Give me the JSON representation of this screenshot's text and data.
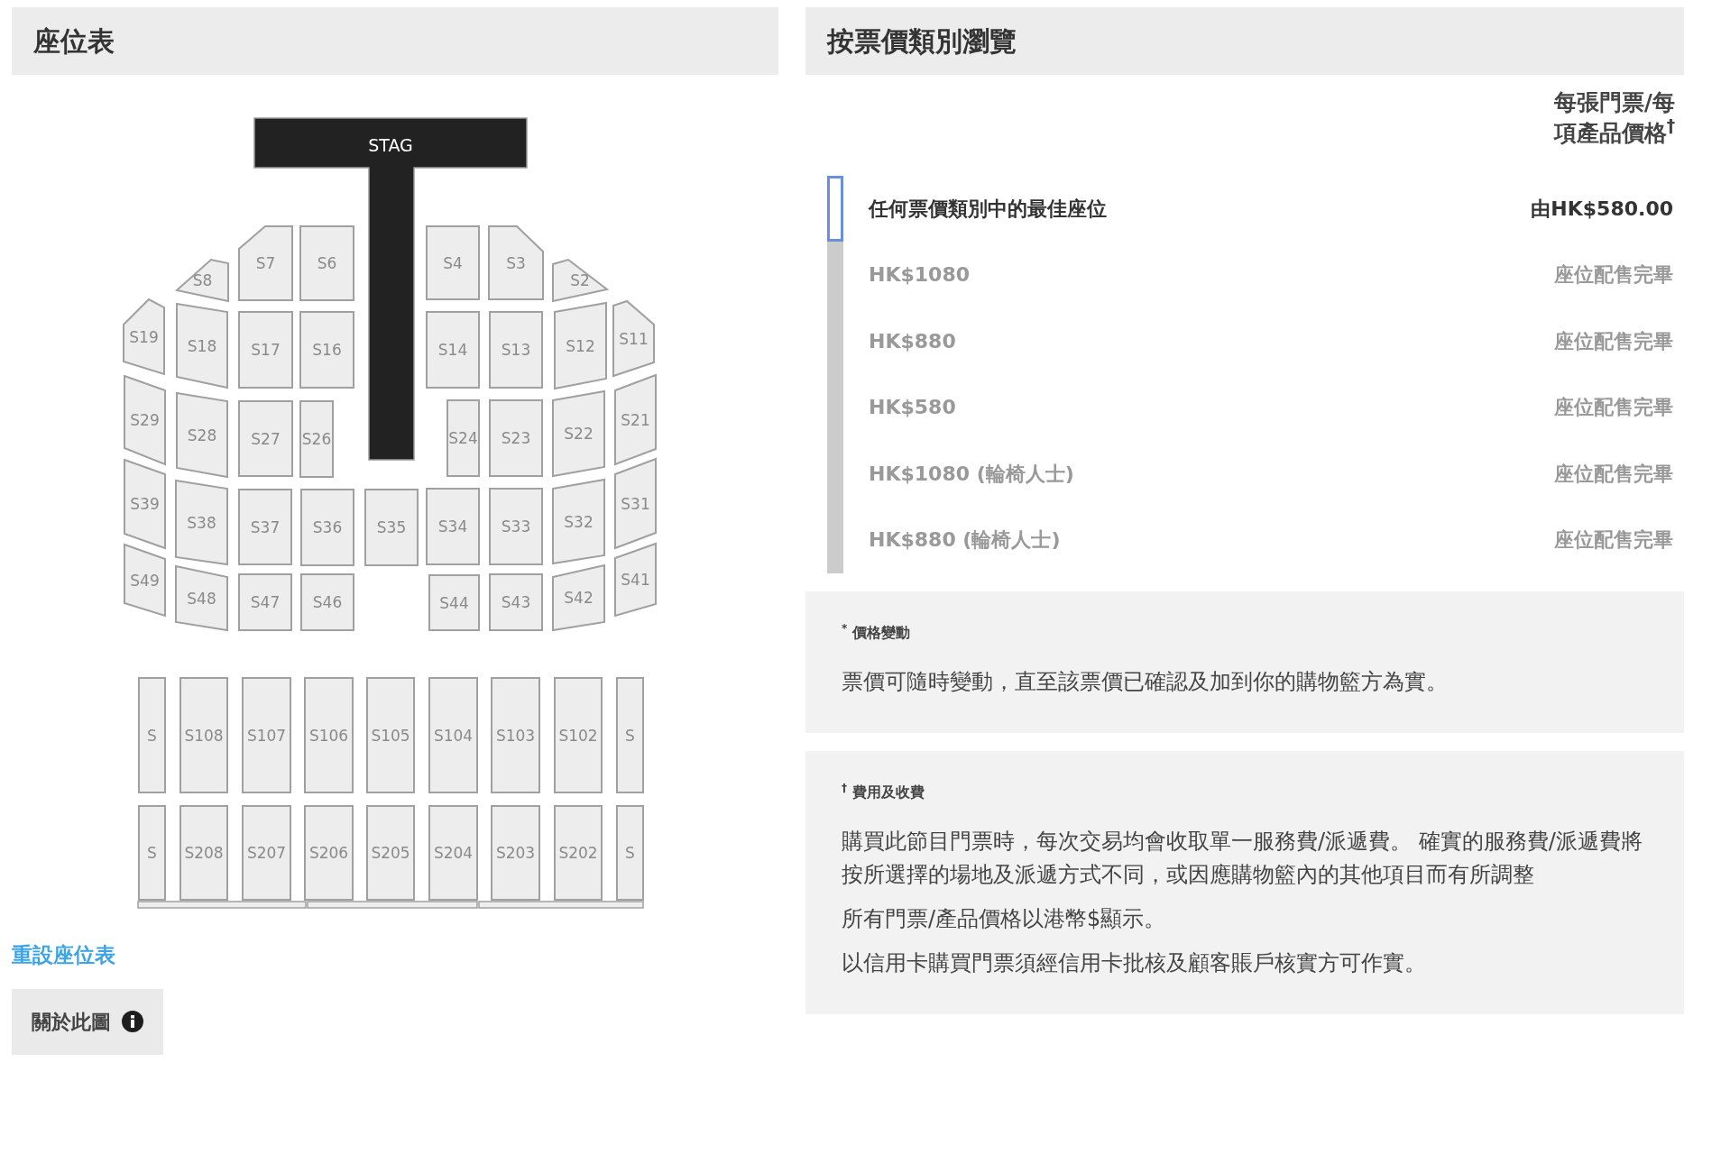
{
  "seat_map": {
    "title": "座位表",
    "stage": {
      "label": "STAG"
    },
    "sections": [
      {
        "label": "S8"
      },
      {
        "label": "S7"
      },
      {
        "label": "S6"
      },
      {
        "label": "S4"
      },
      {
        "label": "S3"
      },
      {
        "label": "S2"
      },
      {
        "label": "S19"
      },
      {
        "label": "S18"
      },
      {
        "label": "S17"
      },
      {
        "label": "S16"
      },
      {
        "label": "S14"
      },
      {
        "label": "S13"
      },
      {
        "label": "S12"
      },
      {
        "label": "S11"
      },
      {
        "label": "S29"
      },
      {
        "label": "S28"
      },
      {
        "label": "S27"
      },
      {
        "label": "S26"
      },
      {
        "label": "S24"
      },
      {
        "label": "S23"
      },
      {
        "label": "S22"
      },
      {
        "label": "S21"
      },
      {
        "label": "S39"
      },
      {
        "label": "S38"
      },
      {
        "label": "S37"
      },
      {
        "label": "S36"
      },
      {
        "label": "S35"
      },
      {
        "label": "S34"
      },
      {
        "label": "S33"
      },
      {
        "label": "S32"
      },
      {
        "label": "S31"
      },
      {
        "label": "S49"
      },
      {
        "label": "S48"
      },
      {
        "label": "S47"
      },
      {
        "label": "S46"
      },
      {
        "label": "S44"
      },
      {
        "label": "S43"
      },
      {
        "label": "S42"
      },
      {
        "label": "S41"
      },
      {
        "label": "S"
      },
      {
        "label": "S108"
      },
      {
        "label": "S107"
      },
      {
        "label": "S106"
      },
      {
        "label": "S105"
      },
      {
        "label": "S104"
      },
      {
        "label": "S103"
      },
      {
        "label": "S102"
      },
      {
        "label": "S"
      },
      {
        "label": "S"
      },
      {
        "label": "S208"
      },
      {
        "label": "S207"
      },
      {
        "label": "S206"
      },
      {
        "label": "S205"
      },
      {
        "label": "S204"
      },
      {
        "label": "S203"
      },
      {
        "label": "S202"
      },
      {
        "label": "S"
      }
    ],
    "reset_link": "重設座位表",
    "about_button": "關於此圖"
  },
  "price_panel": {
    "title": "按票價類別瀏覽",
    "column_header": "每張門票/每項產品價格$^{†}$",
    "rows": [
      {
        "label": "任何票價類別中的最佳座位",
        "price": "由HK$580.00",
        "selected": true,
        "disabled": false
      },
      {
        "label": "HK$1080",
        "price": "座位配售完畢",
        "selected": false,
        "disabled": true
      },
      {
        "label": "HK$880",
        "price": "座位配售完畢",
        "selected": false,
        "disabled": true
      },
      {
        "label": "HK$580",
        "price": "座位配售完畢",
        "selected": false,
        "disabled": true
      },
      {
        "label": "HK$1080 (輪椅人士)",
        "price": "座位配售完畢",
        "selected": false,
        "disabled": true
      },
      {
        "label": "HK$880 (輪椅人士)",
        "price": "座位配售完畢",
        "selected": false,
        "disabled": true
      }
    ]
  },
  "notes": [
    {
      "heading": "$^{*}$ 價格變動",
      "paragraphs": [
        "票價可隨時變動，直至該票價已確認及加到你的購物籃方為實。"
      ]
    },
    {
      "heading": "$^{†}$ 費用及收費",
      "paragraphs": [
        "購買此節目門票時，每次交易均會收取單一服務費/派遞費。 確實的服務費/派遞費將按所選擇的場地及派遞方式不同，或因應購物籃內的其他項目而有所調整",
        "所有門票/產品價格以港幣$顯示。",
        "以信用卡購買門票須經信用卡批核及顧客賬戶核實方可作實。"
      ]
    }
  ]
}
